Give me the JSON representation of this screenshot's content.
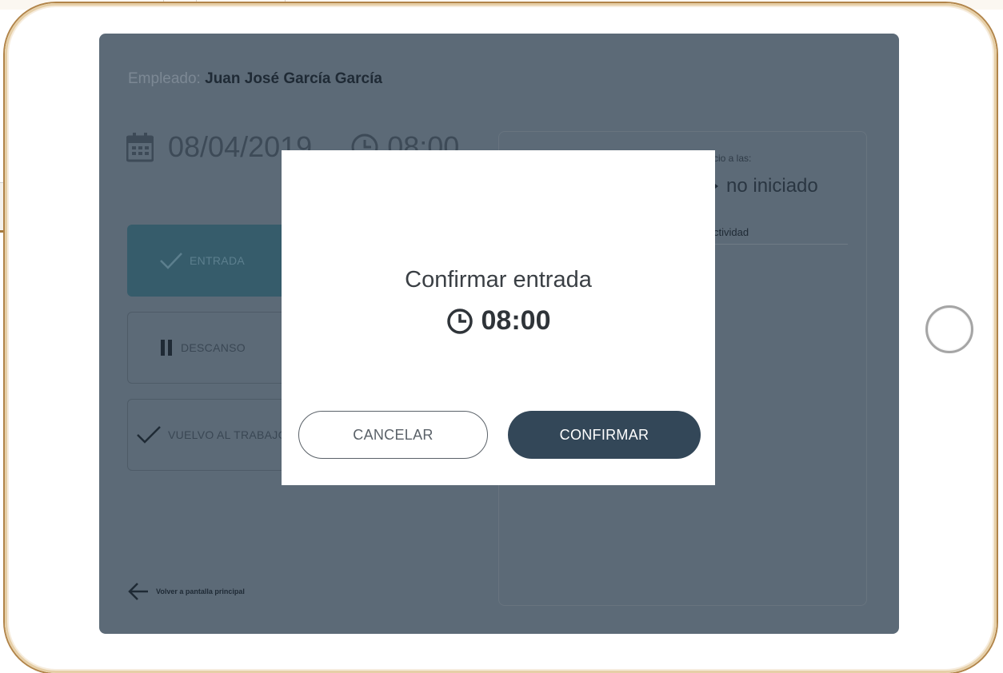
{
  "employee": {
    "label": "Empleado:",
    "name": "Juan José García García"
  },
  "date": "08/04/2019",
  "time": "08:00",
  "actions": {
    "entrada": "ENTRADA",
    "descanso": "DESCANSO",
    "vuelvo": "VUELVO AL TRABAJO"
  },
  "status_panel": {
    "inicio_label": "cio a las:",
    "status": "no iniciado",
    "actividad_label": "ctividad"
  },
  "back_link": "Volver a pantalla principal",
  "modal": {
    "title": "Confirmar entrada",
    "time": "08:00",
    "cancel_label": "CANCELAR",
    "confirm_label": "CONFIRMAR"
  },
  "colors": {
    "overlay": "#5c6a77",
    "accent": "#334758",
    "entrada_button": "#365c6b"
  }
}
